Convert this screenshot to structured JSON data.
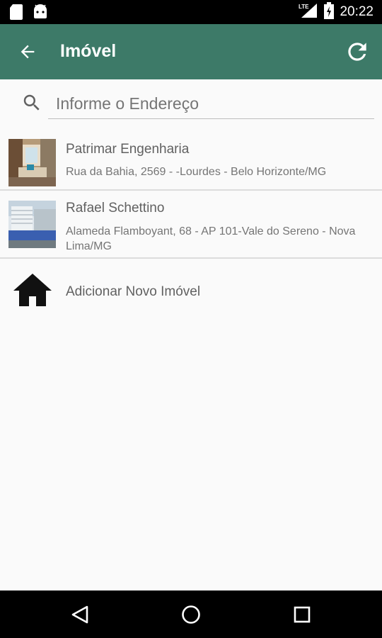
{
  "status_bar": {
    "network_label": "LTE",
    "time": "20:22",
    "icons": [
      "sd-card-icon",
      "android-icon",
      "signal-icon",
      "battery-icon"
    ]
  },
  "app_bar": {
    "title": "Imóvel",
    "back_icon": "arrow-back-icon",
    "refresh_icon": "refresh-icon",
    "background_color": "#3d7a68"
  },
  "search": {
    "placeholder": "Informe o Endereço",
    "value": ""
  },
  "properties": [
    {
      "name": "Patrimar Engenharia",
      "address": "Rua da Bahia, 2569 - -Lourdes - Belo Horizonte/MG"
    },
    {
      "name": "Rafael Schettino",
      "address": "Alameda Flamboyant, 68 - AP 101-Vale do Sereno - Nova Lima/MG"
    }
  ],
  "add_property": {
    "label": "Adicionar Novo Imóvel",
    "icon": "home-icon"
  },
  "nav_bar": {
    "icons": [
      "back-triangle-icon",
      "home-circle-icon",
      "recents-square-icon"
    ]
  }
}
